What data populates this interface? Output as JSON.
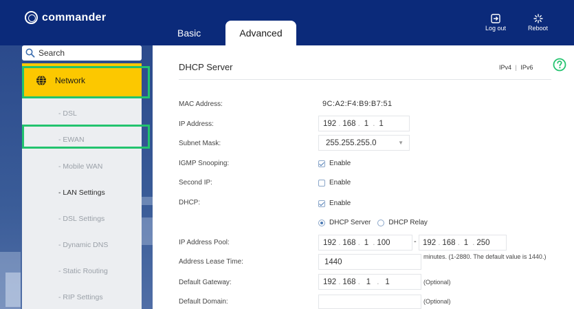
{
  "brand": {
    "name": "commander"
  },
  "tabs": [
    {
      "label": "Basic",
      "active": false
    },
    {
      "label": "Advanced",
      "active": true
    }
  ],
  "header_actions": {
    "logout": "Log out",
    "reboot": "Reboot"
  },
  "sidebar": {
    "search_label": "Search",
    "network_label": "Network",
    "items": [
      {
        "label": "- DSL",
        "active": false
      },
      {
        "label": "- EWAN",
        "active": false
      },
      {
        "label": "- Mobile WAN",
        "active": false
      },
      {
        "label": "- LAN Settings",
        "active": true
      },
      {
        "label": "- DSL Settings",
        "active": false
      },
      {
        "label": "- Dynamic DNS",
        "active": false
      },
      {
        "label": "- Static Routing",
        "active": false
      },
      {
        "label": "- RIP Settings",
        "active": false
      }
    ]
  },
  "main": {
    "title": "DHCP Server",
    "ip_toggle": {
      "ipv4": "IPv4",
      "sep": "|",
      "ipv6": "IPv6"
    },
    "mac": {
      "label": "MAC Address:",
      "value": "9C:A2:F4:B9:B7:51"
    },
    "ip": {
      "label": "IP Address:",
      "octets": [
        "192",
        "168",
        "1",
        "1"
      ]
    },
    "subnet": {
      "label": "Subnet Mask:",
      "value": "255.255.255.0"
    },
    "igmp": {
      "label": "IGMP Snooping:",
      "option": "Enable",
      "checked": true
    },
    "second_ip": {
      "label": "Second IP:",
      "option": "Enable",
      "checked": false
    },
    "dhcp": {
      "label": "DHCP:",
      "option": "Enable",
      "checked": true,
      "mode_server": "DHCP Server",
      "mode_relay": "DHCP Relay",
      "selected": "DHCP Server"
    },
    "pool": {
      "label": "IP Address Pool:",
      "start": [
        "192",
        "168",
        "1",
        "100"
      ],
      "separator": "-",
      "end": [
        "192",
        "168",
        "1",
        "250"
      ]
    },
    "lease": {
      "label": "Address Lease Time:",
      "value": "1440",
      "hint": "minutes. (1-2880. The default value is 1440.)"
    },
    "gateway": {
      "label": "Default Gateway:",
      "octets": [
        "192",
        "168",
        "1",
        "1"
      ],
      "hint": "(Optional)"
    },
    "domain": {
      "label": "Default Domain:",
      "value": "",
      "hint": "(Optional)"
    }
  },
  "colors": {
    "header_bg": "#0b2a7a",
    "accent_yellow": "#fcc800",
    "highlight_green": "#22c36e",
    "sidebar_panel": "#eceef1"
  }
}
